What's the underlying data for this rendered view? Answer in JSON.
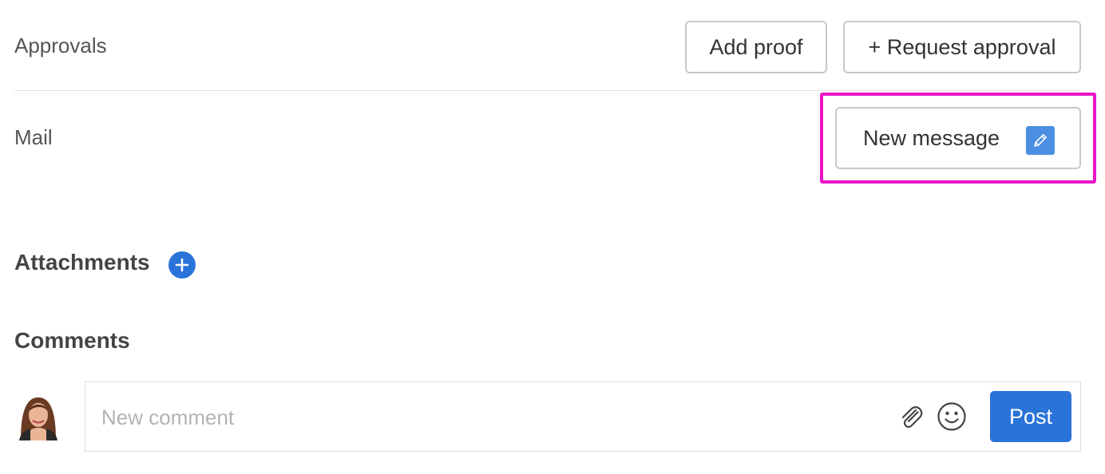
{
  "approvals": {
    "label": "Approvals",
    "add_proof_label": "Add proof",
    "request_approval_label": "+ Request approval"
  },
  "mail": {
    "label": "Mail",
    "new_message_label": "New message",
    "new_message_icon": "pencil-icon"
  },
  "attachments": {
    "heading": "Attachments",
    "add_icon": "plus-circle-icon"
  },
  "comments": {
    "heading": "Comments",
    "input_placeholder": "New comment",
    "input_value": "",
    "attach_icon": "paperclip-icon",
    "emoji_icon": "smiley-icon",
    "post_label": "Post"
  },
  "colors": {
    "accent": "#2a73d9",
    "highlight": "#e815c8",
    "pencil_bg": "#4a8fe2"
  }
}
